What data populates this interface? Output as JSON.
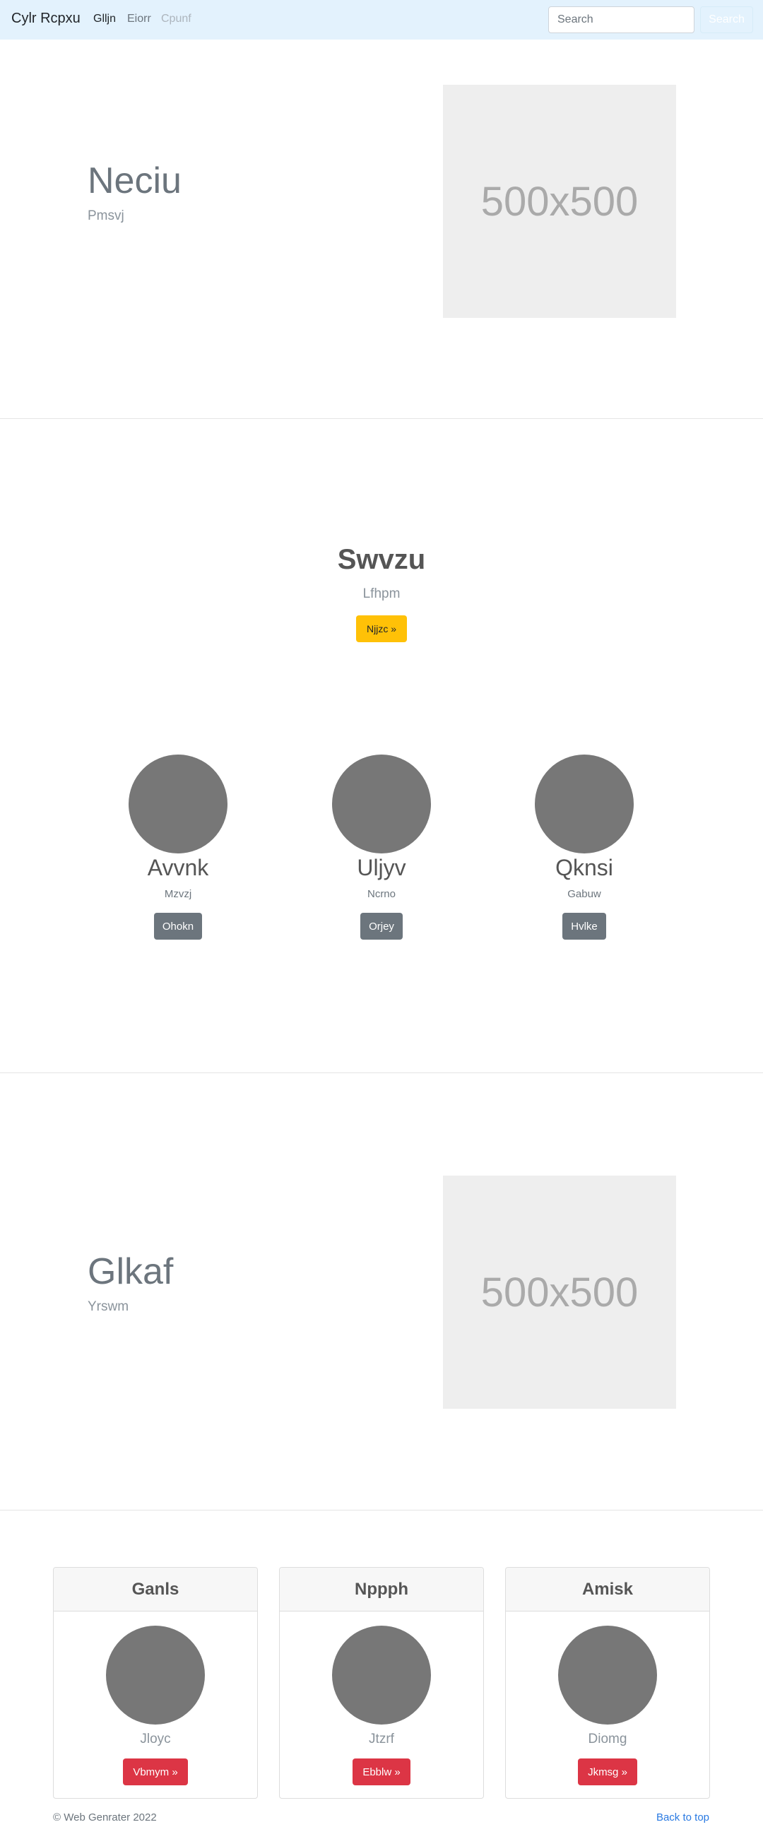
{
  "navbar": {
    "brand": "Cylr Rcpxu",
    "links": [
      "Glljn",
      "Eiorr",
      "Cpunf"
    ],
    "search_placeholder": "Search",
    "search_button": "Search"
  },
  "feature1": {
    "heading": "Neciu",
    "sub": "Pmsvj",
    "image_label": "500x500"
  },
  "cta": {
    "heading": "Swvzu",
    "sub": "Lfhpm",
    "button": "Njjzc »"
  },
  "profiles": [
    {
      "title": "Avvnk",
      "sub": "Mzvzj",
      "button": "Ohokn"
    },
    {
      "title": "Uljyv",
      "sub": "Ncrno",
      "button": "Orjey"
    },
    {
      "title": "Qknsi",
      "sub": "Gabuw",
      "button": "Hvlke"
    }
  ],
  "feature2": {
    "heading": "Glkaf",
    "sub": "Yrswm",
    "image_label": "500x500"
  },
  "cards": [
    {
      "header": "Ganls",
      "sub": "Jloyc",
      "button": "Vbmym »"
    },
    {
      "header": "Nppph",
      "sub": "Jtzrf",
      "button": "Ebblw »"
    },
    {
      "header": "Amisk",
      "sub": "Diomg",
      "button": "Jkmsg »"
    }
  ],
  "footer": {
    "copyright": "© Web Genrater 2022",
    "back_to_top": "Back to top"
  },
  "colors": {
    "navbar_bg": "#e3f2fd",
    "warning": "#ffc107",
    "secondary": "#6c757d",
    "danger": "#dc3545",
    "link": "#2a7ae2"
  }
}
